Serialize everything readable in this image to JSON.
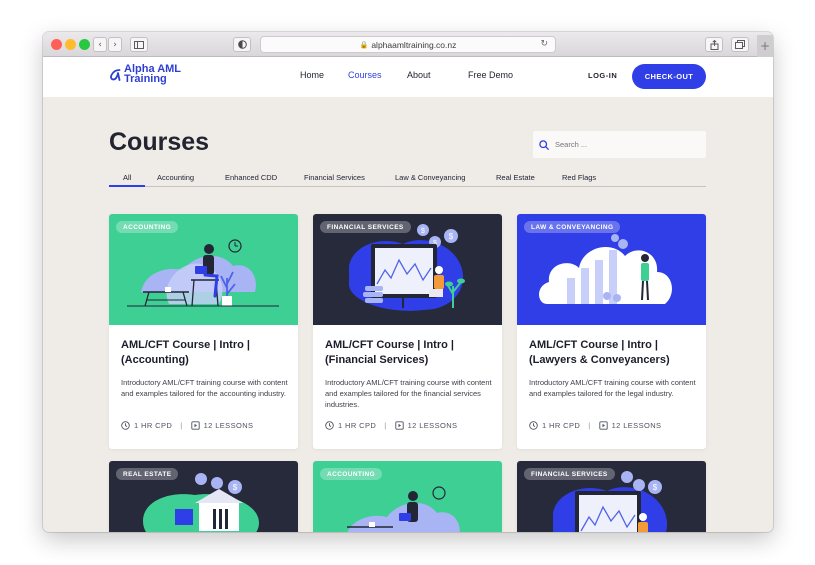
{
  "browser": {
    "url": "alphaamltraining.co.nz"
  },
  "header": {
    "logo_line1": "Alpha AML",
    "logo_line2": "Training",
    "nav": [
      "Home",
      "Courses",
      "About",
      "Free Demo"
    ],
    "login": "LOG-IN",
    "checkout": "CHECK-OUT"
  },
  "main": {
    "title": "Courses",
    "search_placeholder": "Search ...",
    "tabs": [
      "All",
      "Accounting",
      "Enhanced CDD",
      "Financial Services",
      "Law & Conveyancing",
      "Real Estate",
      "Red Flags"
    ],
    "active_tab": "All"
  },
  "cards": [
    {
      "badge": "ACCOUNTING",
      "color": "#3ecf95",
      "title": "AML/CFT Course | Intro | (Accounting)",
      "description": "Introductory AML/CFT training course with content and examples tailored for the accounting industry.",
      "cpd": "1 HR CPD",
      "lessons": "12 LESSONS"
    },
    {
      "badge": "FINANCIAL SERVICES",
      "color": "#262a3b",
      "title": "AML/CFT Course | Intro | (Financial Services)",
      "description": "Introductory AML/CFT training course with content and examples tailored for the financial services industries.",
      "cpd": "1 HR CPD",
      "lessons": "12 LESSONS"
    },
    {
      "badge": "LAW & CONVEYANCING",
      "color": "#2f3ee6",
      "title": "AML/CFT Course | Intro | (Lawyers & Conveyancers)",
      "description": "Introductory AML/CFT training course with content and examples tailored for the legal industry.",
      "cpd": "1 HR CPD",
      "lessons": "12 LESSONS"
    },
    {
      "badge": "REAL ESTATE",
      "color": "#262a3b"
    },
    {
      "badge": "ACCOUNTING",
      "color": "#3ecf95"
    },
    {
      "badge": "FINANCIAL SERVICES",
      "color": "#262a3b"
    }
  ],
  "colors": {
    "accent": "#2f3ee6",
    "background": "#efebe7"
  }
}
